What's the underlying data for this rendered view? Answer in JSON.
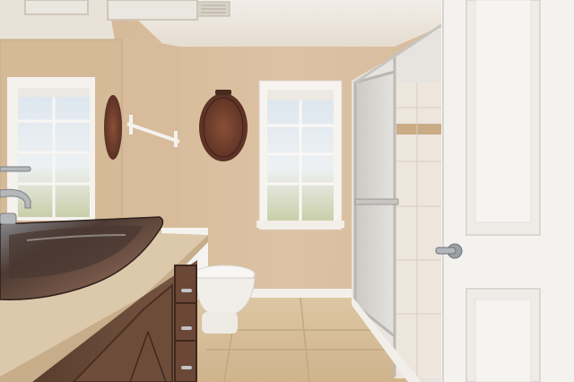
{
  "scene": {
    "description_colors": {
      "wall": "#d6bb9c",
      "ceiling": "#ece7df",
      "floor_tile": "#d6bd98",
      "door": "#f3f1ee",
      "vanity_wood": "#6b4c3a",
      "counter": "#d8c3a4"
    },
    "objects": [
      "ceiling-vent",
      "mirror",
      "window-left-reflected",
      "window-center",
      "wall-basket-left",
      "wall-basket-center",
      "towel-bar",
      "vessel-sink",
      "faucet",
      "vanity",
      "toilet",
      "shower-enclosure",
      "shower-handle",
      "door",
      "door-handle",
      "tile-floor"
    ]
  }
}
